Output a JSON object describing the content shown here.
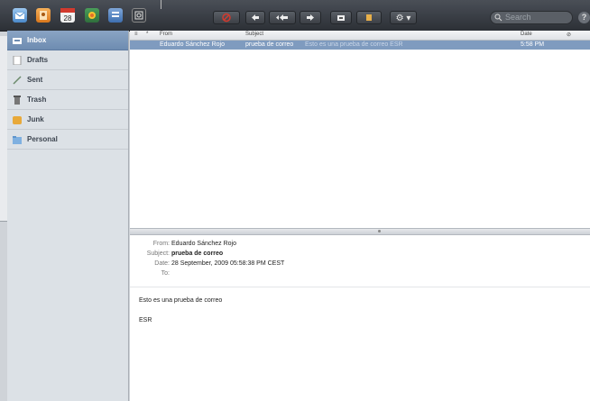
{
  "colors": {
    "accent": "#7f9bbf",
    "toolbar": "#33373d",
    "delete": "#d23a2e"
  },
  "calendar_day": "28",
  "toolbar": {
    "options_label": "⚙ ▾",
    "search_placeholder": "Search",
    "help_label": "?"
  },
  "sidebar": {
    "items": [
      {
        "label": "Inbox",
        "icon": "inbox-icon"
      },
      {
        "label": "Drafts",
        "icon": "drafts-icon"
      },
      {
        "label": "Sent",
        "icon": "sent-icon"
      },
      {
        "label": "Trash",
        "icon": "trash-icon"
      },
      {
        "label": "Junk",
        "icon": "junk-icon"
      },
      {
        "label": "Personal",
        "icon": "folder-icon"
      }
    ]
  },
  "list": {
    "columns": {
      "star": "*",
      "from": "From",
      "subject": "Subject",
      "date": "Date",
      "attach": "⊘"
    },
    "rows": [
      {
        "from": "Eduardo Sánchez Rojo",
        "subject": "prueba de correo",
        "preview": "Esto es una prueba de correo ESR",
        "date": "5:58 PM"
      }
    ]
  },
  "message": {
    "from_label": "From:",
    "from": "Eduardo Sánchez Rojo",
    "subject_label": "Subject:",
    "subject": "prueba de correo",
    "date_label": "Date:",
    "date": "28 September, 2009 05:58:38 PM CEST",
    "to_label": "To:",
    "to": "",
    "body_line1": "Esto es una prueba de correo",
    "body_line2": "ESR"
  }
}
